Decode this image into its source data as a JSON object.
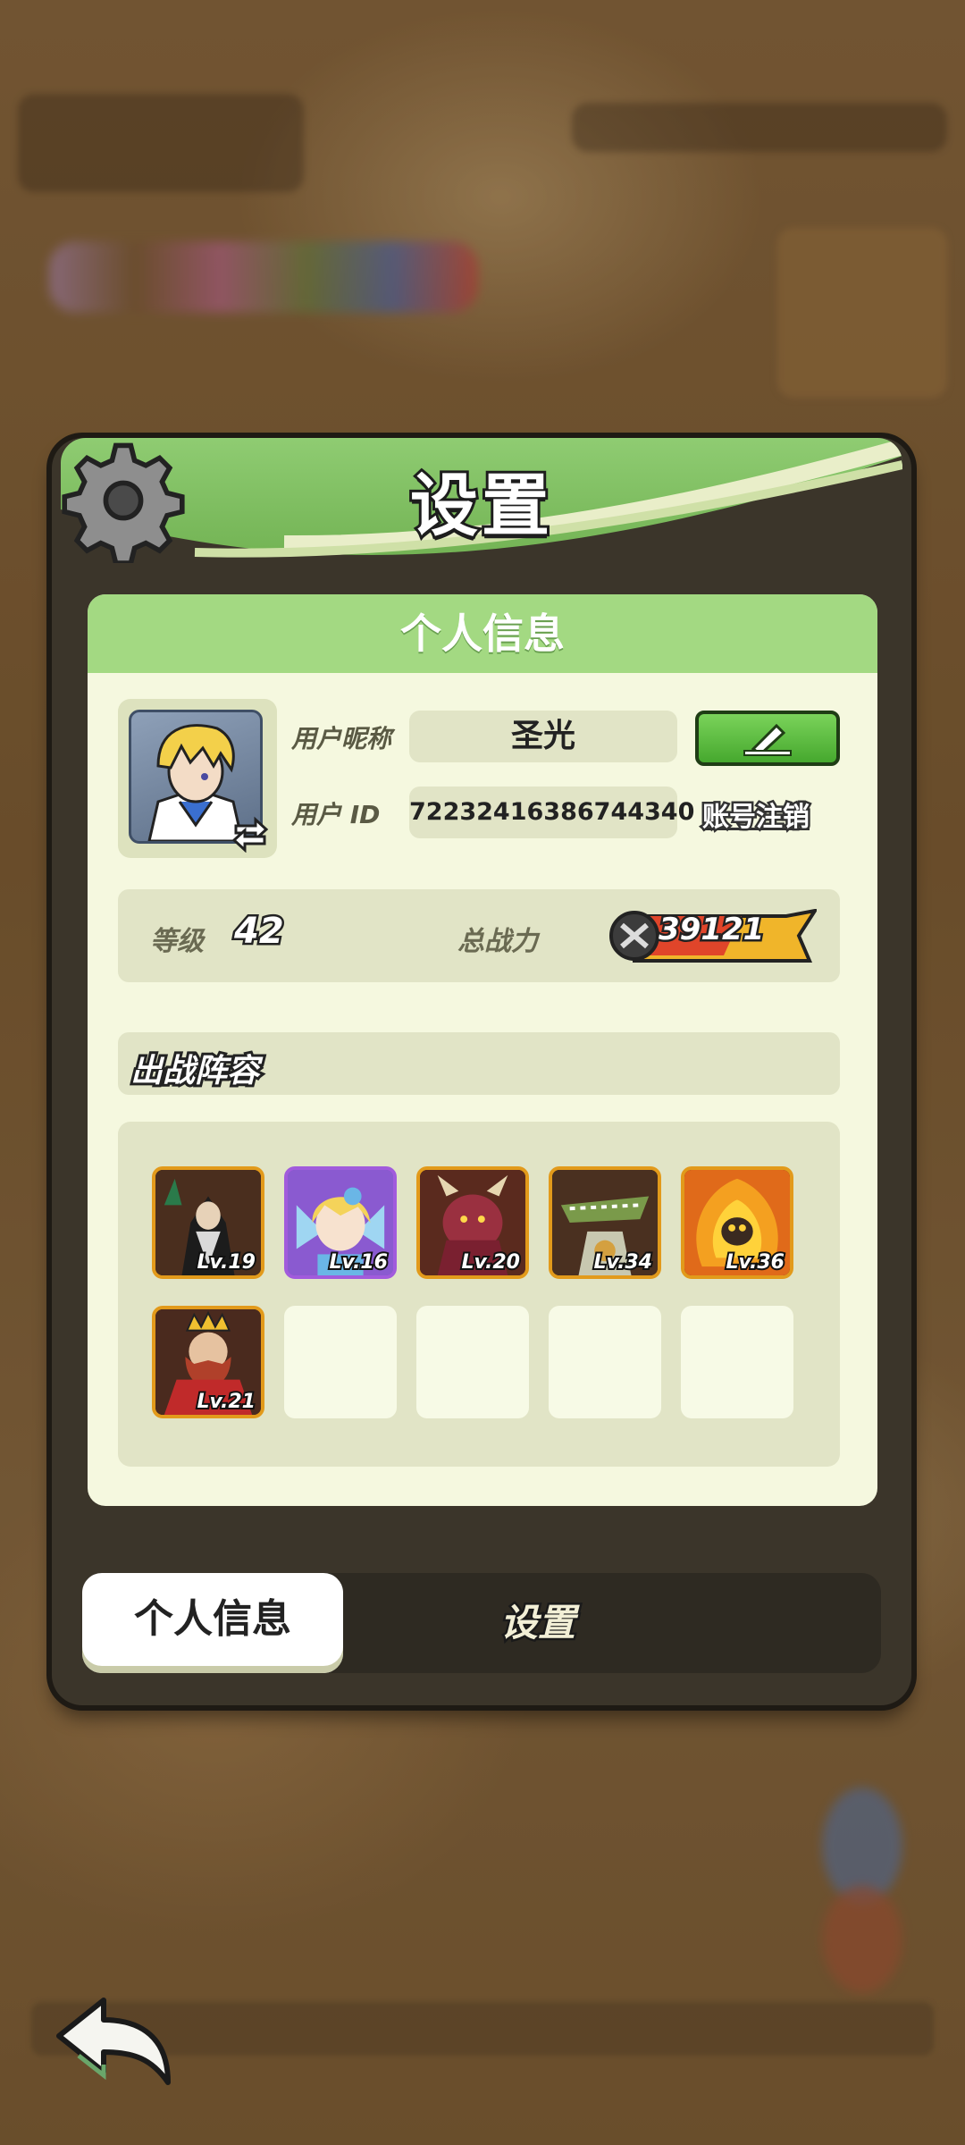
{
  "panel": {
    "title": "设置",
    "section_title": "个人信息"
  },
  "profile": {
    "nickname_label": "用户昵称",
    "nickname": "圣光",
    "id_label": "用户 ID",
    "user_id": "72232416386744340",
    "cancel_account": "账号注销"
  },
  "stats": {
    "level_label": "等级",
    "level": "42",
    "power_label": "总战力",
    "power": "39121"
  },
  "lineup": {
    "title": "出战阵容",
    "heroes": [
      {
        "level": "Lv.19"
      },
      {
        "level": "Lv.16"
      },
      {
        "level": "Lv.20"
      },
      {
        "level": "Lv.34"
      },
      {
        "level": "Lv.36"
      },
      {
        "level": "Lv.21"
      }
    ]
  },
  "tabs": {
    "profile": "个人信息",
    "settings": "设置"
  },
  "colors": {
    "header_green": "#8fcc72",
    "content_bg": "#f5f8df",
    "edit_green": "#46a82e",
    "hero_frame": "#e29a1b",
    "rare_frame": "#a15bdc"
  }
}
